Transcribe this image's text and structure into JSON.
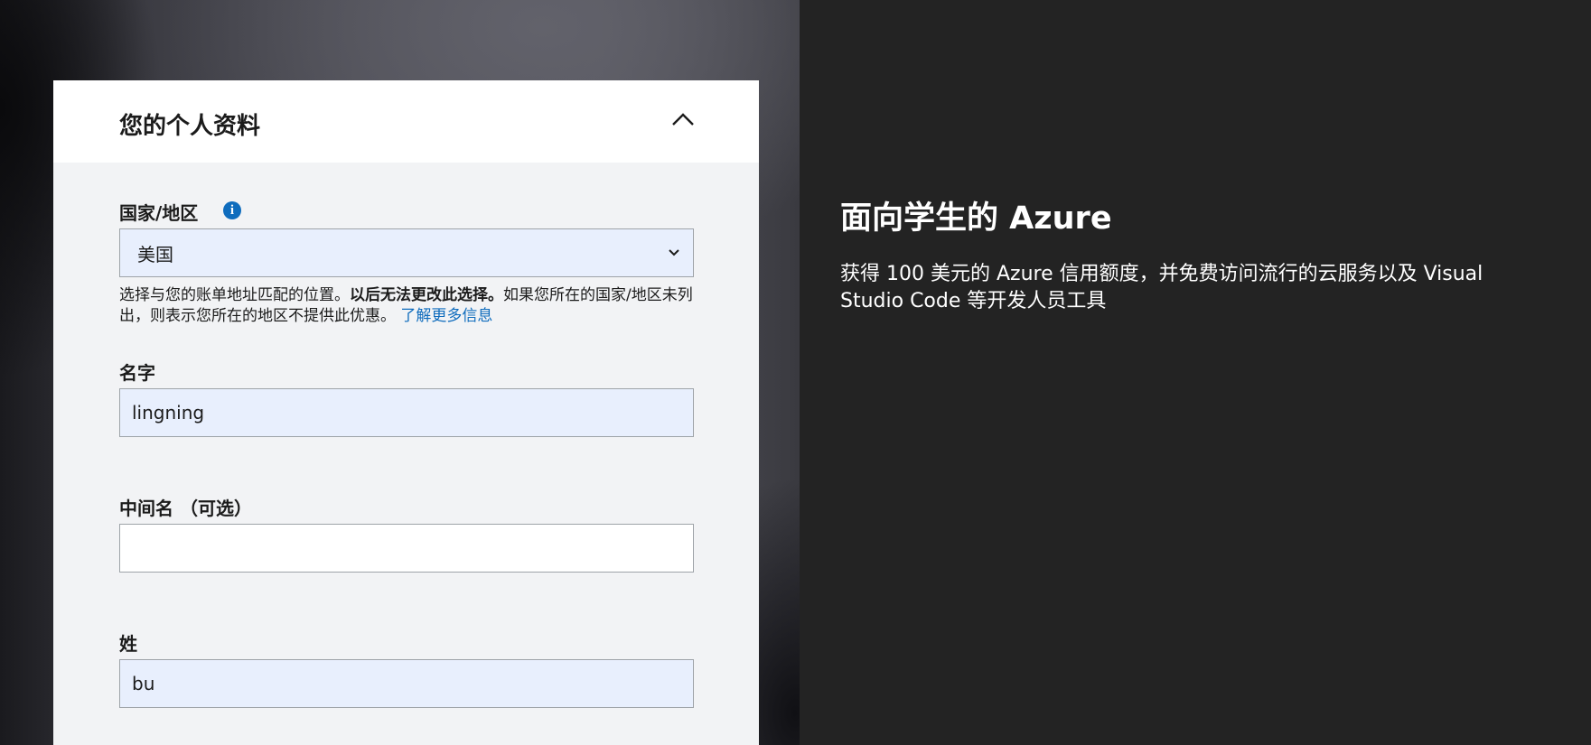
{
  "form": {
    "section_title": "您的个人资料",
    "country": {
      "label": "国家/地区",
      "value": "美国",
      "hint_prefix": "选择与您的账单地址匹配的位置。",
      "hint_bold": "以后无法更改此选择。",
      "hint_suffix": "如果您所在的国家/地区未列出，则表示您所在的地区不提供此优惠。",
      "learn_more": "了解更多信息"
    },
    "first_name": {
      "label": "名字",
      "value": "lingning"
    },
    "middle_name": {
      "label": "中间名 （可选）",
      "value": ""
    },
    "last_name": {
      "label": "姓",
      "value": "bu"
    }
  },
  "promo": {
    "title": "面向学生的 Azure",
    "description": "获得 100 美元的 Azure 信用额度，并免费访问流行的云服务以及 Visual Studio Code 等开发人员工具"
  },
  "colors": {
    "link": "#0f6cbd",
    "filled_input_bg": "#e8effd",
    "right_panel_bg": "#232323"
  },
  "icons": {
    "collapse": "chevron-up-icon",
    "info": "info-icon",
    "select": "chevron-down-icon"
  }
}
